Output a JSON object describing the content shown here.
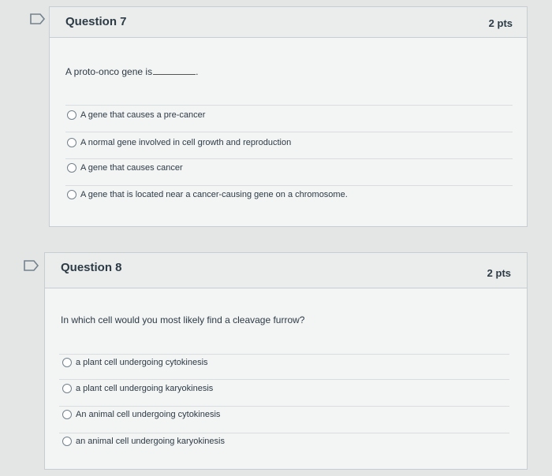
{
  "questions": [
    {
      "title": "Question 7",
      "points": "2 pts",
      "prompt": "A proto-onco gene is",
      "prompt_suffix": ".",
      "options": [
        "A gene that causes a pre-cancer",
        "A normal gene involved in cell growth and reproduction",
        "A gene that causes cancer",
        "A gene that is located near a cancer-causing gene on a chromosome."
      ]
    },
    {
      "title": "Question 8",
      "points": "2 pts",
      "prompt": "In which cell would you most likely find a cleavage furrow?",
      "options": [
        "a plant cell undergoing cytokinesis",
        "a plant cell undergoing karyokinesis",
        "An animal cell undergoing cytokinesis",
        "an animal cell undergoing karyokinesis"
      ]
    }
  ],
  "colors": {
    "text": "#2d3b45",
    "border": "#c7cdd1",
    "bookmark": "#73818b"
  },
  "icons": [
    "bookmark-flag-icon",
    "radio-button-icon"
  ]
}
